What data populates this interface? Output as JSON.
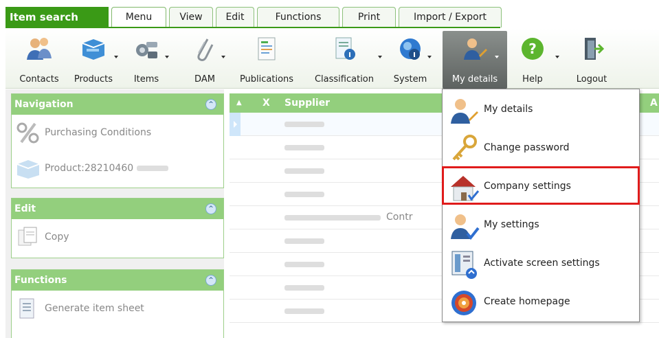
{
  "app": {
    "title": "Item search"
  },
  "tabs": [
    {
      "label": "Menu",
      "active": true
    },
    {
      "label": "View",
      "active": false
    },
    {
      "label": "Edit",
      "active": false
    },
    {
      "label": "Functions",
      "active": false
    },
    {
      "label": "Print",
      "active": false
    },
    {
      "label": "Import / Export",
      "active": false
    }
  ],
  "toolbar": {
    "items": [
      {
        "label": "Contacts",
        "icon": "contacts-icon"
      },
      {
        "label": "Products",
        "icon": "products-icon"
      },
      {
        "label": "Items",
        "icon": "items-icon"
      },
      {
        "label": "DAM",
        "icon": "paperclip-icon"
      },
      {
        "label": "Publications",
        "icon": "publications-icon"
      },
      {
        "label": "Classification",
        "icon": "classification-icon"
      },
      {
        "label": "System",
        "icon": "system-info-icon"
      },
      {
        "label": "My details",
        "icon": "user-edit-icon",
        "pressed": true
      },
      {
        "label": "Help",
        "icon": "help-icon"
      },
      {
        "label": "Logout",
        "icon": "logout-icon"
      }
    ]
  },
  "sidebar": {
    "navigation": {
      "title": "Navigation",
      "items": [
        {
          "label": "Purchasing Conditions"
        },
        {
          "label": "Product:28210460"
        }
      ]
    },
    "edit": {
      "title": "Edit",
      "items": [
        {
          "label": "Copy"
        }
      ]
    },
    "functions": {
      "title": "Functions",
      "items": [
        {
          "label": "Generate item sheet"
        }
      ]
    }
  },
  "grid": {
    "headers": {
      "sort": "▲",
      "x": "X",
      "supplier": "Supplier",
      "next": "A"
    },
    "row5_text": "Contr"
  },
  "dropdown": {
    "items": [
      {
        "label": "My details",
        "icon": "user-edit-icon"
      },
      {
        "label": "Change password",
        "icon": "key-icon"
      },
      {
        "label": "Company settings",
        "icon": "house-icon",
        "highlighted": true
      },
      {
        "label": "My settings",
        "icon": "user-check-icon"
      },
      {
        "label": "Activate screen settings",
        "icon": "screen-settings-icon"
      },
      {
        "label": "Create homepage",
        "icon": "target-icon"
      }
    ]
  },
  "colors": {
    "accent_green": "#3a9a16",
    "panel_green": "#93cf7d",
    "highlight_red": "#e01b1b"
  }
}
